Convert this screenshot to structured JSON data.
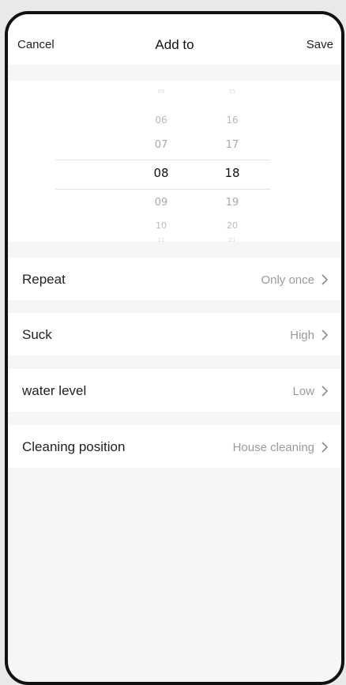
{
  "header": {
    "cancel_label": "Cancel",
    "title": "Add to",
    "save_label": "Save"
  },
  "time_picker": {
    "hours": [
      "05",
      "06",
      "07",
      "08",
      "09",
      "10",
      "11"
    ],
    "minutes": [
      "15",
      "16",
      "17",
      "18",
      "19",
      "20",
      "21"
    ],
    "selected_hour": "08",
    "selected_minute": "18"
  },
  "settings": [
    {
      "label": "Repeat",
      "value": "Only once",
      "icon": "chevron-right-icon"
    },
    {
      "label": "Suck",
      "value": "High",
      "icon": "chevron-right-icon"
    },
    {
      "label": "water level",
      "value": "Low",
      "icon": "chevron-right-icon"
    },
    {
      "label": "Cleaning position",
      "value": "House cleaning",
      "icon": "chevron-right-icon"
    }
  ],
  "colors": {
    "background": "#f6f6f6",
    "panel": "#ffffff",
    "text": "#222222",
    "secondary_text": "#9a9a9a",
    "frame": "#111111"
  }
}
